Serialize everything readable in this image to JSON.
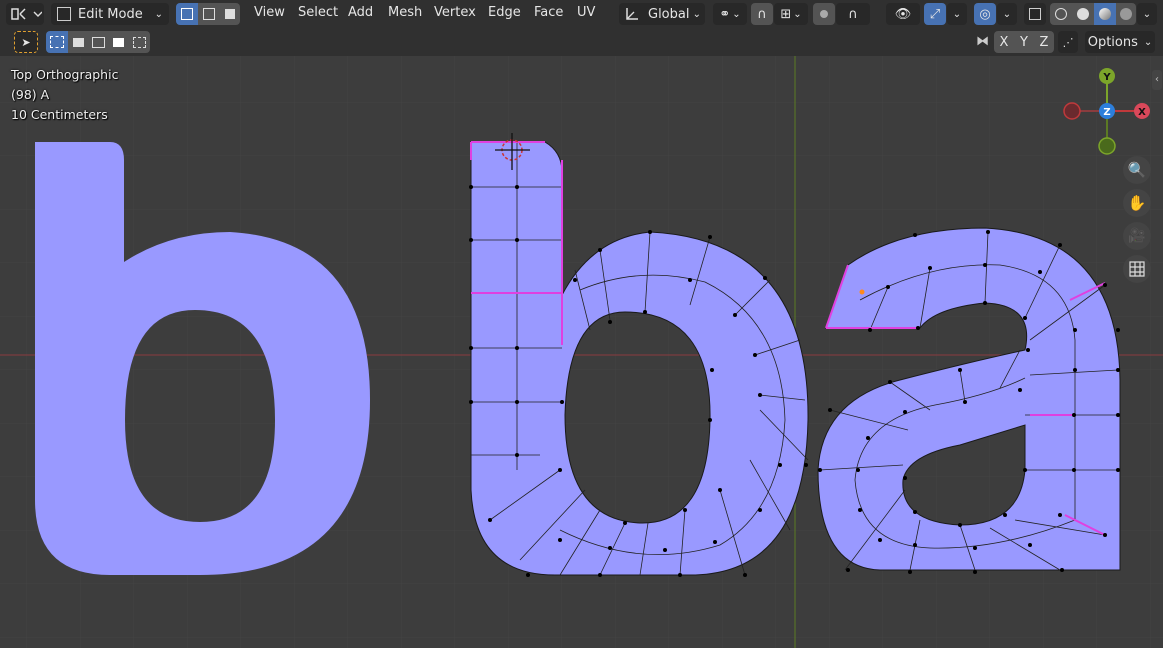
{
  "header": {
    "mode_label": "Edit Mode",
    "menus": [
      "View",
      "Select",
      "Add",
      "Mesh",
      "Vertex",
      "Edge",
      "Face",
      "UV"
    ],
    "orientation_label": "Global",
    "options_label": "Options",
    "axes": [
      "X",
      "Y",
      "Z"
    ]
  },
  "overlay": {
    "view_name": "Top Orthographic",
    "object_info": "(98) A",
    "scale": "10 Centimeters"
  },
  "gizmo": {
    "y": "Y",
    "z": "Z",
    "x": "X"
  },
  "colors": {
    "face": "#9999ff",
    "selected_edge": "#e040e0",
    "x_axis": "#c0393b",
    "y_axis": "#7ca52a",
    "header": "#303030",
    "viewport": "#3d3d3d",
    "accent": "#4772b3"
  }
}
